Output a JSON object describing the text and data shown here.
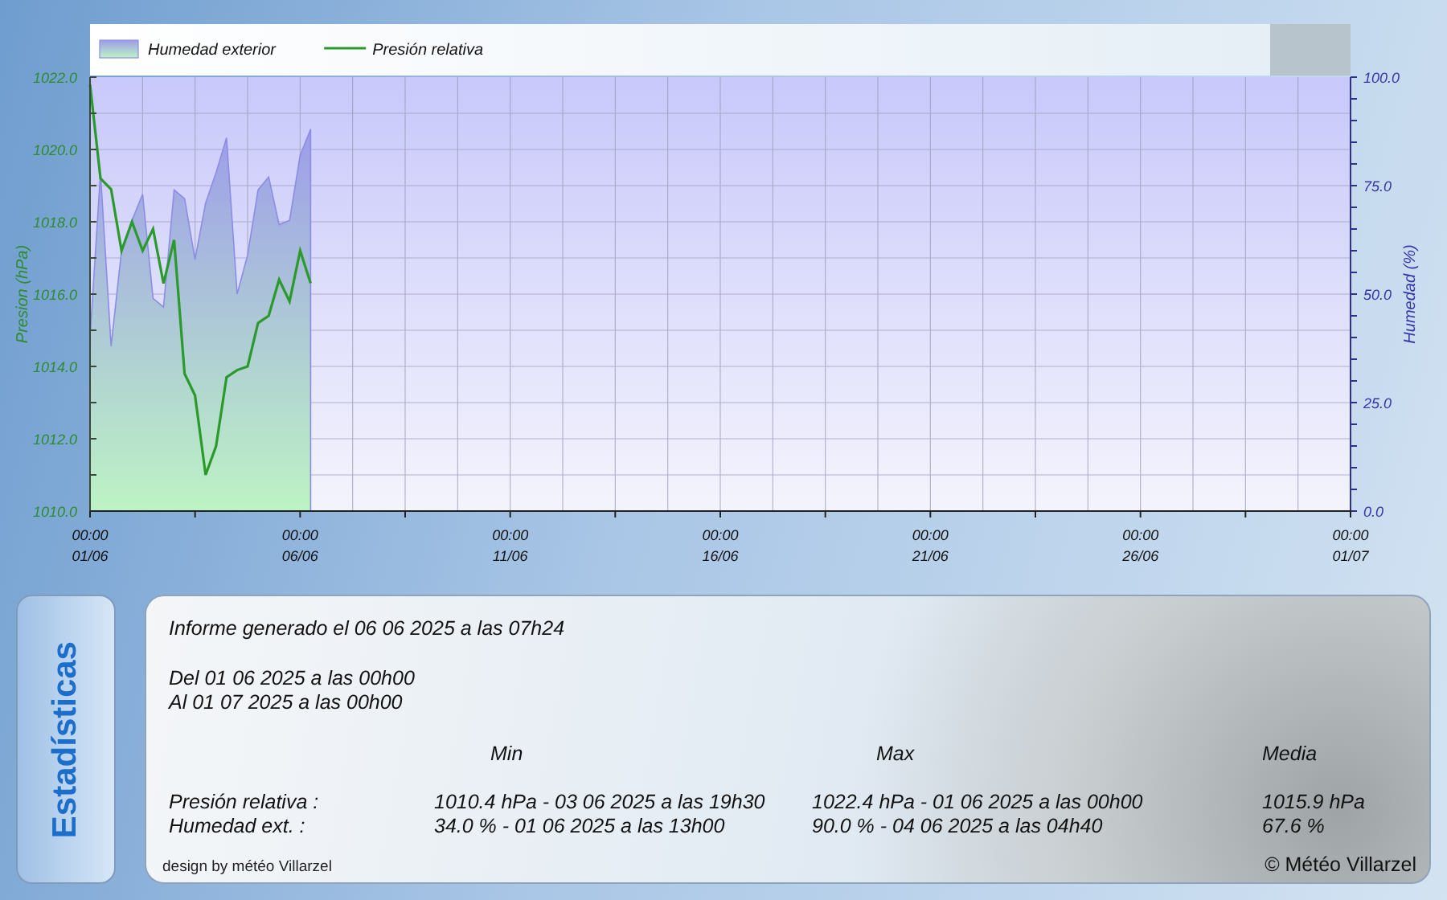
{
  "chart": {
    "chart_data": {
      "type": "line",
      "grid": true,
      "legend": "top",
      "ylabel": "Presion (hPa)",
      "y2label": "Humedad (%)",
      "categories": [
        "00:00\n01/06",
        null,
        null,
        null,
        null,
        null,
        null,
        null,
        null,
        null,
        null,
        null,
        null,
        null,
        null,
        null,
        null,
        null,
        null,
        null,
        "00:00\n06/06",
        null,
        null,
        null,
        null,
        null,
        null,
        null,
        null,
        null,
        null,
        null,
        null,
        null,
        null,
        null,
        null,
        null,
        null,
        null,
        "00:00\n11/06",
        null,
        null,
        null,
        null,
        null,
        null,
        null,
        null,
        null,
        null,
        null,
        null,
        null,
        null,
        null,
        null,
        null,
        null,
        null,
        "00:00\n16/06",
        null,
        null,
        null,
        null,
        null,
        null,
        null,
        null,
        null,
        null,
        null,
        null,
        null,
        null,
        null,
        null,
        null,
        null,
        null,
        "00:00\n21/06",
        null,
        null,
        null,
        null,
        null,
        null,
        null,
        null,
        null,
        null,
        null,
        null,
        null,
        null,
        null,
        null,
        null,
        null,
        null,
        "00:00\n26/06",
        null,
        null,
        null,
        null,
        null,
        null,
        null,
        null,
        null,
        null,
        null,
        null,
        null,
        null,
        null,
        null,
        null,
        null,
        null,
        "00:00\n01/07"
      ],
      "ylim": [
        1010,
        1022
      ],
      "y2lim": [
        0,
        100
      ],
      "yticks": [
        {
          "value": 1010,
          "label": "1010.0"
        },
        {
          "value": 1012,
          "label": "1012.0"
        },
        {
          "value": 1014,
          "label": "1014.0"
        },
        {
          "value": 1016,
          "label": "1016.0"
        },
        {
          "value": 1018,
          "label": "1018.0"
        },
        {
          "value": 1020,
          "label": "1020.0"
        },
        {
          "value": 1022,
          "label": "1022.0"
        }
      ],
      "y2ticks": [
        {
          "value": 0,
          "label": "0.0"
        },
        {
          "value": 25,
          "label": "25.0"
        },
        {
          "value": 50,
          "label": "50.0"
        },
        {
          "value": 75,
          "label": "75.0"
        },
        {
          "value": 100,
          "label": "100.0"
        }
      ],
      "series": [
        {
          "name": "Humedad exterior",
          "type": "area",
          "axis": "y2",
          "color": "#8c8ce6",
          "values": [
            40,
            78,
            38,
            60,
            67,
            73,
            49,
            47,
            74,
            72,
            58,
            71,
            78,
            86,
            50,
            59,
            74,
            77,
            66,
            67,
            82,
            88,
            null,
            null,
            null,
            null,
            null,
            null,
            null,
            null,
            null,
            null,
            null,
            null,
            null,
            null,
            null,
            null,
            null,
            null,
            null,
            null,
            null,
            null,
            null,
            null,
            null,
            null,
            null,
            null,
            null,
            null,
            null,
            null,
            null,
            null,
            null,
            null,
            null,
            null,
            null,
            null,
            null,
            null,
            null,
            null,
            null,
            null,
            null,
            null,
            null,
            null,
            null,
            null,
            null,
            null,
            null,
            null,
            null,
            null,
            null,
            null,
            null,
            null,
            null,
            null,
            null,
            null,
            null,
            null,
            null,
            null,
            null,
            null,
            null,
            null,
            null,
            null,
            null,
            null,
            null,
            null,
            null,
            null,
            null,
            null,
            null,
            null,
            null,
            null,
            null,
            null,
            null,
            null,
            null,
            null,
            null,
            null,
            null,
            null,
            null
          ]
        },
        {
          "name": "Presión relativa",
          "color": "#2a9a2a",
          "values": [
            1021.8,
            1019.2,
            1018.9,
            1017.2,
            1018.0,
            1017.2,
            1017.8,
            1016.3,
            1017.5,
            1013.8,
            1013.2,
            1011.0,
            1011.8,
            1013.7,
            1013.9,
            1014.0,
            1015.2,
            1015.4,
            1016.4,
            1015.8,
            1017.2,
            1016.3,
            null,
            null,
            null,
            null,
            null,
            null,
            null,
            null,
            null,
            null,
            null,
            null,
            null,
            null,
            null,
            null,
            null,
            null,
            null,
            null,
            null,
            null,
            null,
            null,
            null,
            null,
            null,
            null,
            null,
            null,
            null,
            null,
            null,
            null,
            null,
            null,
            null,
            null,
            null,
            null,
            null,
            null,
            null,
            null,
            null,
            null,
            null,
            null,
            null,
            null,
            null,
            null,
            null,
            null,
            null,
            null,
            null,
            null,
            null,
            null,
            null,
            null,
            null,
            null,
            null,
            null,
            null,
            null,
            null,
            null,
            null,
            null,
            null,
            null,
            null,
            null,
            null,
            null,
            null,
            null,
            null,
            null,
            null,
            null,
            null,
            null,
            null,
            null,
            null,
            null,
            null,
            null,
            null,
            null,
            null,
            null,
            null,
            null,
            null
          ]
        }
      ]
    }
  },
  "stats_tab": {
    "label": "Estadísticas"
  },
  "stats": {
    "generated": "Informe generado el 06 06 2025 a las 07h24",
    "from": "Del 01 06 2025 a las 00h00",
    "to": "Al 01 07 2025 a las 00h00",
    "columns": [
      "Min",
      "Max",
      "Media"
    ],
    "rows": [
      {
        "label": "Presión relativa :",
        "min": "1010.4 hPa - 03 06 2025 a las 19h30",
        "max": "1022.4 hPa - 01 06 2025 a las 00h00",
        "mean": "1015.9 hPa"
      },
      {
        "label": "Humedad ext. :",
        "min": "34.0 % - 01 06 2025 a las 13h00",
        "max": "90.0 % - 04 06 2025 a las 04h40",
        "mean": "67.6 %"
      }
    ],
    "design_credit": "design by météo Villarzel",
    "copyright": "© Météo Villarzel"
  }
}
